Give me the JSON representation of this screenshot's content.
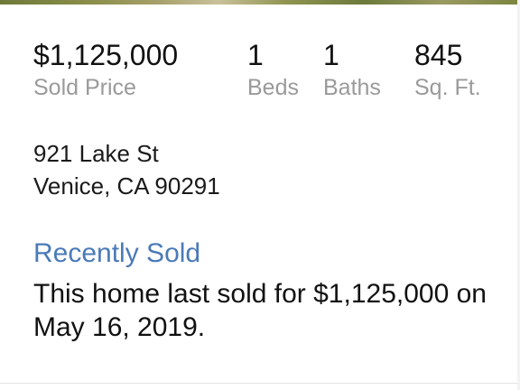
{
  "stats": {
    "price": {
      "value": "$1,125,000",
      "label": "Sold Price"
    },
    "beds": {
      "value": "1",
      "label": "Beds"
    },
    "baths": {
      "value": "1",
      "label": "Baths"
    },
    "sqft": {
      "value": "845",
      "label": "Sq. Ft."
    }
  },
  "address": {
    "line1": "921 Lake St",
    "line2": "Venice, CA 90291"
  },
  "recently_sold": {
    "title": "Recently Sold",
    "body": "This home last sold for $1,125,000 on May 16, 2019."
  },
  "colors": {
    "accent": "#4a7ab8",
    "label_gray": "#9a9a9a"
  }
}
